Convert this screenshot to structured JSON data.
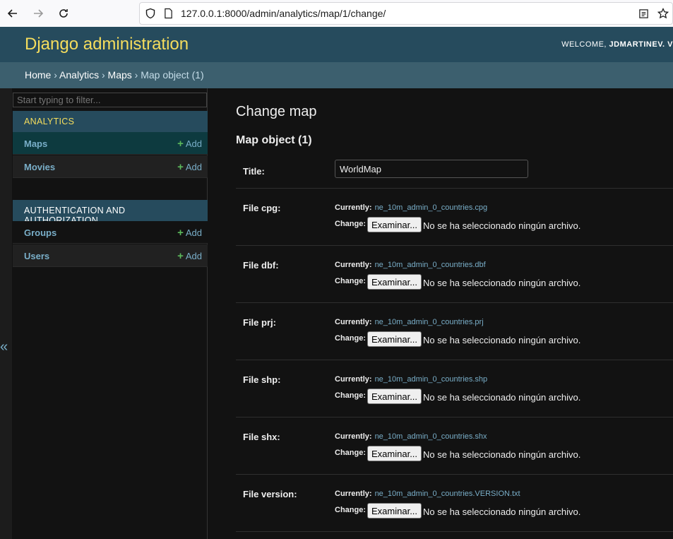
{
  "browser": {
    "url": "127.0.0.1:8000/admin/analytics/map/1/change/"
  },
  "header": {
    "branding": "Django administration",
    "welcome": "WELCOME,",
    "user": "JDMARTINEV. V"
  },
  "breadcrumbs": {
    "home": "Home",
    "app": "Analytics",
    "model": "Maps",
    "current": "Map object (1)",
    "sep": "›"
  },
  "sidebar": {
    "filter_placeholder": "Start typing to filter...",
    "modules": [
      {
        "caption": "ANALYTICS",
        "models": [
          {
            "name": "Maps",
            "add": "Add"
          },
          {
            "name": "Movies",
            "add": "Add"
          }
        ]
      },
      {
        "caption": "AUTHENTICATION AND AUTHORIZATION",
        "models": [
          {
            "name": "Groups",
            "add": "Add"
          },
          {
            "name": "Users",
            "add": "Add"
          }
        ]
      }
    ],
    "toggle": "«"
  },
  "content": {
    "title": "Change map",
    "object_title": "Map object (1)",
    "title_field": {
      "label": "Title:",
      "value": "WorldMap"
    },
    "currently_label": "Currently:",
    "change_label": "Change:",
    "browse_button": "Examinar...",
    "no_file": "No se ha seleccionado ningún archivo.",
    "file_fields": [
      {
        "label": "File cpg:",
        "file": "ne_10m_admin_0_countries.cpg"
      },
      {
        "label": "File dbf:",
        "file": "ne_10m_admin_0_countries.dbf"
      },
      {
        "label": "File prj:",
        "file": "ne_10m_admin_0_countries.prj"
      },
      {
        "label": "File shp:",
        "file": "ne_10m_admin_0_countries.shp"
      },
      {
        "label": "File shx:",
        "file": "ne_10m_admin_0_countries.shx"
      },
      {
        "label": "File version:",
        "file": "ne_10m_admin_0_countries.VERSION.txt"
      }
    ]
  },
  "colors": {
    "header_bg": "#264b5d",
    "breadcrumb_bg": "#3c5f6e",
    "accent_yellow": "#f5dd5d",
    "link_blue": "#79aec8",
    "add_green": "#5bb75b"
  }
}
